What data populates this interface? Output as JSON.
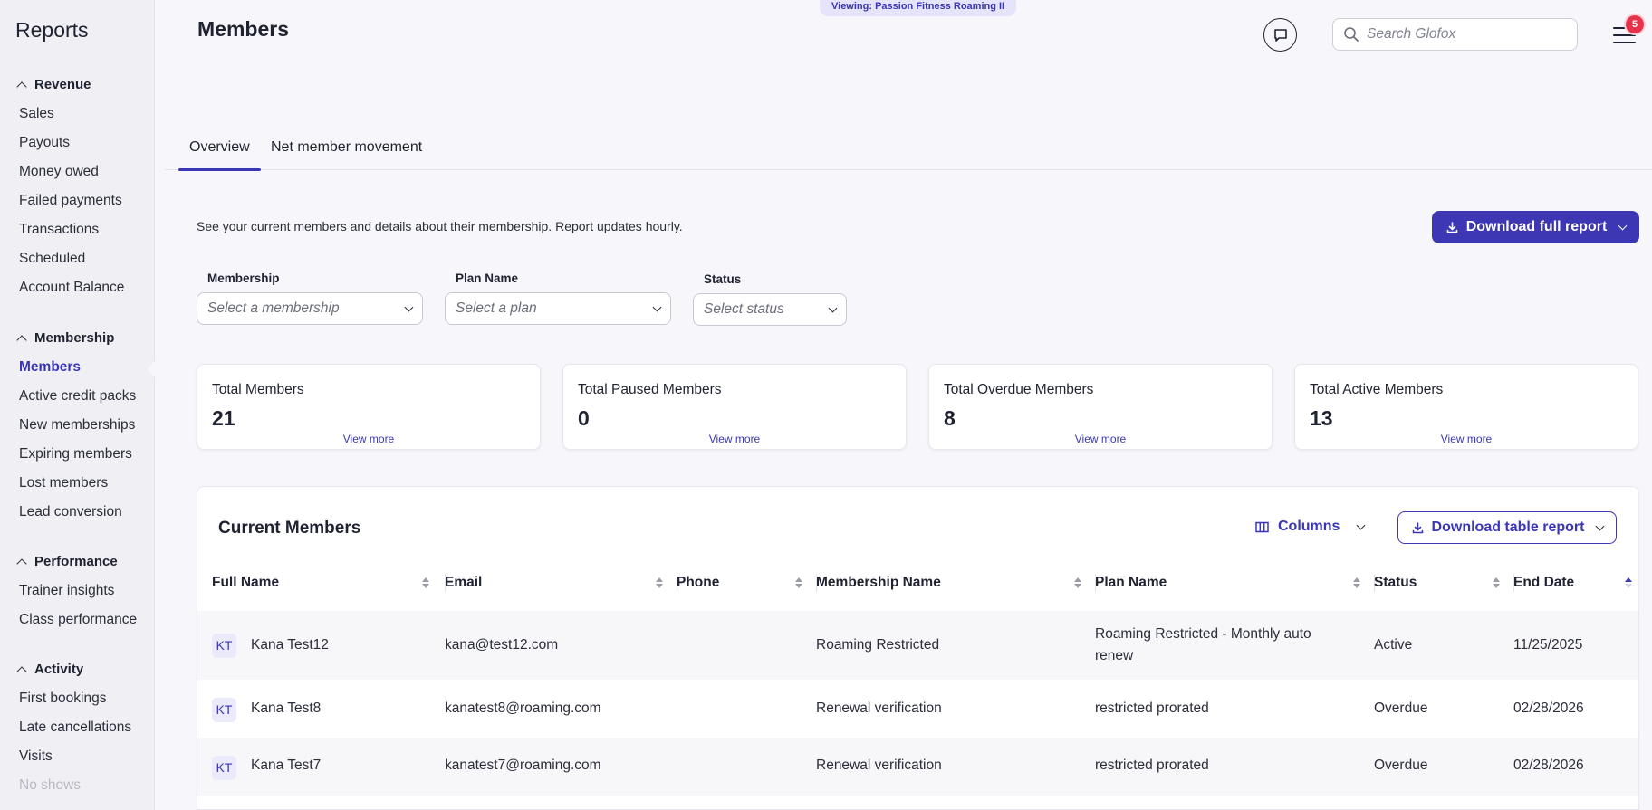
{
  "sidebar": {
    "title": "Reports",
    "sections": [
      {
        "label": "Revenue",
        "items": [
          "Sales",
          "Payouts",
          "Money owed",
          "Failed payments",
          "Transactions",
          "Scheduled",
          "Account Balance"
        ]
      },
      {
        "label": "Membership",
        "items": [
          "Members",
          "Active credit packs",
          "New memberships",
          "Expiring members",
          "Lost members",
          "Lead conversion"
        ]
      },
      {
        "label": "Performance",
        "items": [
          "Trainer insights",
          "Class performance"
        ]
      },
      {
        "label": "Activity",
        "items": [
          "First bookings",
          "Late cancellations",
          "Visits",
          "No shows"
        ]
      }
    ],
    "active_item": "Members"
  },
  "header": {
    "title": "Members",
    "viewing_badge": "Viewing: Passion Fitness Roaming II",
    "search_placeholder": "Search Glofox",
    "notification_count": "5"
  },
  "tabs": [
    "Overview",
    "Net member movement"
  ],
  "description": "See your current members and details about their membership. Report updates hourly.",
  "download_full_label": "Download full report",
  "filters": [
    {
      "label": "Membership",
      "placeholder": "Select a membership"
    },
    {
      "label": "Plan Name",
      "placeholder": "Select a plan"
    },
    {
      "label": "Status",
      "placeholder": "Select status"
    }
  ],
  "stats": [
    {
      "label": "Total Members",
      "value": "21",
      "link": "View more"
    },
    {
      "label": "Total Paused Members",
      "value": "0",
      "link": "View more"
    },
    {
      "label": "Total Overdue Members",
      "value": "8",
      "link": "View more"
    },
    {
      "label": "Total Active Members",
      "value": "13",
      "link": "View more"
    }
  ],
  "table": {
    "title": "Current Members",
    "columns_label": "Columns",
    "download_label": "Download table report",
    "headers": [
      "Full Name",
      "Email",
      "Phone",
      "Membership Name",
      "Plan Name",
      "Status",
      "End Date"
    ],
    "rows": [
      {
        "initials": "KT",
        "name": "Kana Test12",
        "email": "kana@test12.com",
        "phone": "",
        "membership": "Roaming Restricted",
        "plan": "Roaming Restricted - Monthly auto renew",
        "status": "Active",
        "end_date": "11/25/2025"
      },
      {
        "initials": "KT",
        "name": "Kana Test8",
        "email": "kanatest8@roaming.com",
        "phone": "",
        "membership": "Renewal verification",
        "plan": "restricted prorated",
        "status": "Overdue",
        "end_date": "02/28/2026"
      },
      {
        "initials": "KT",
        "name": "Kana Test7",
        "email": "kanatest7@roaming.com",
        "phone": "",
        "membership": "Renewal verification",
        "plan": "restricted prorated",
        "status": "Overdue",
        "end_date": "02/28/2026"
      }
    ]
  },
  "colors": {
    "accent": "#3d37b4",
    "notification": "#e5334b",
    "sidebar_bg": "#f0f0f4"
  }
}
